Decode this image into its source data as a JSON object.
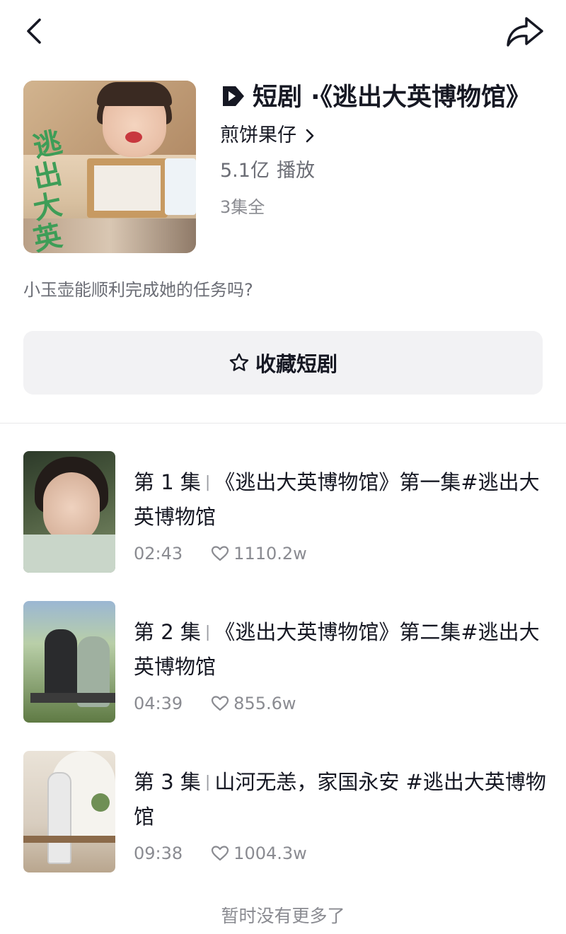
{
  "header": {
    "back_icon": "chevron-left-icon",
    "share_icon": "share-arrow-icon"
  },
  "drama": {
    "badge_icon": "short-drama-play-icon",
    "title": "短剧 ·《逃出大英博物馆》",
    "author": "煎饼果仔",
    "plays_value": "5.1亿",
    "plays_label": "播放",
    "episodes_count": "3集全",
    "cover_text": "逃出大英博物馆",
    "description": "小玉壶能顺利完成她的任务吗?"
  },
  "favorite_button": {
    "label": "收藏短剧",
    "icon": "star-outline-icon"
  },
  "episodes": [
    {
      "label": "第 1 集",
      "separator": "|",
      "title": "《逃出大英博物馆》第一集#逃出大英博物馆",
      "duration": "02:43",
      "likes": "1110.2w"
    },
    {
      "label": "第 2 集",
      "separator": "|",
      "title": "《逃出大英博物馆》第二集#逃出大英博物馆",
      "duration": "04:39",
      "likes": "855.6w"
    },
    {
      "label": "第 3 集",
      "separator": "|",
      "title": "山河无恙，家国永安 #逃出大英博物馆",
      "duration": "09:38",
      "likes": "1004.3w"
    }
  ],
  "footer": {
    "no_more": "暂时没有更多了"
  },
  "colors": {
    "text_primary": "#161823",
    "text_secondary": "#8a8b91",
    "button_bg": "#f2f2f4",
    "cover_title_green": "#3e9d57"
  }
}
